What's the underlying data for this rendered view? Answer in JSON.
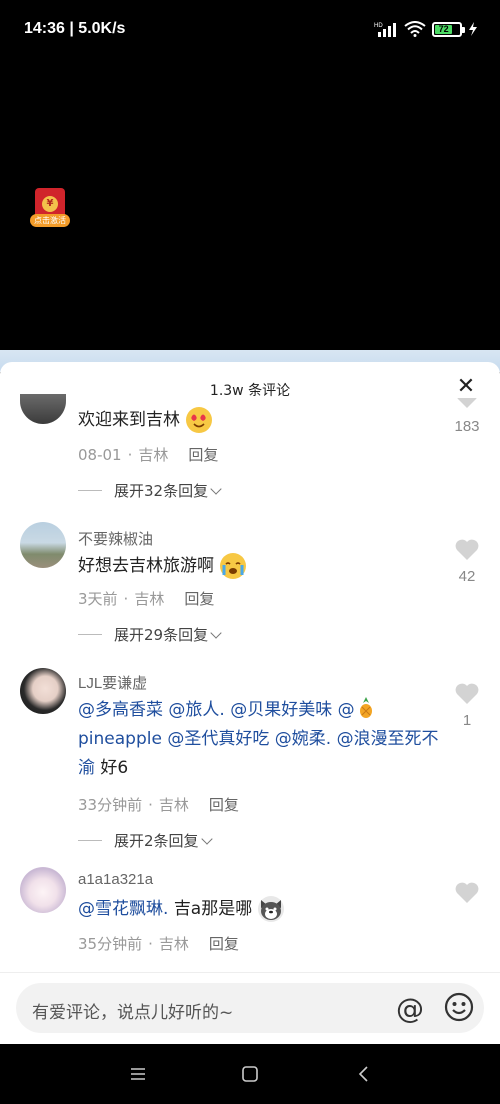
{
  "status": {
    "time": "14:36 | 5.0K/s",
    "battery": "72"
  },
  "video": {
    "redpacket_label": "点击激活",
    "redpacket_symbol": "¥"
  },
  "sheet": {
    "title": "1.3w 条评论",
    "close": "✕"
  },
  "comments": [
    {
      "name": "",
      "text": "欢迎来到吉林",
      "emoji": "heart-eyes",
      "meta": {
        "time": "08-01",
        "location": "吉林",
        "reply": "回复"
      },
      "likes": "183",
      "expand": "展开32条回复"
    },
    {
      "name": "不要辣椒油",
      "text": "好想去吉林旅游啊",
      "emoji": "crying-face",
      "meta": {
        "time": "3天前",
        "location": "吉林",
        "reply": "回复"
      },
      "likes": "42",
      "expand": "展开29条回复"
    },
    {
      "name": "LJL要谦虚",
      "mentions": [
        "@多高香菜",
        "@旅人.",
        "@贝果好美味",
        "@",
        "pineapple",
        "@圣代真好吃",
        "@婉柔.",
        "@浪漫至死不渝"
      ],
      "tail": "好6",
      "emoji_inline": "pineapple",
      "meta": {
        "time": "33分钟前",
        "location": "吉林",
        "reply": "回复"
      },
      "likes": "1",
      "expand": "展开2条回复"
    },
    {
      "name": "a1a1a321a",
      "mention": "@雪花飘琳.",
      "text": "吉a那是哪",
      "emoji": "husky",
      "meta": {
        "time": "35分钟前",
        "location": "吉林",
        "reply": "回复"
      },
      "likes": "",
      "expand": ""
    }
  ],
  "input": {
    "placeholder": "有爱评论，说点儿好听的~",
    "at": "@"
  },
  "colors": {
    "mention": "#1f4e9e",
    "band": "#d8e6f3"
  }
}
